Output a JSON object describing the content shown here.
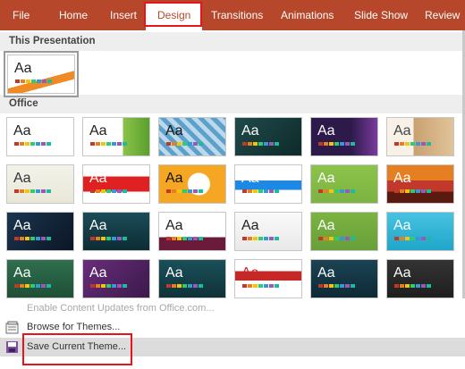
{
  "ribbon": {
    "tabs": [
      {
        "label": "File"
      },
      {
        "label": "Home"
      },
      {
        "label": "Insert"
      },
      {
        "label": "Design"
      },
      {
        "label": "Transitions"
      },
      {
        "label": "Animations"
      },
      {
        "label": "Slide Show"
      },
      {
        "label": "Review"
      }
    ],
    "active_tab": "Design"
  },
  "gallery": {
    "this_presentation_heading": "This Presentation",
    "office_heading": "Office",
    "sample_text": "Aa"
  },
  "menu": {
    "enable_updates": "Enable Content Updates from Office.com...",
    "browse_themes": "Browse for Themes...",
    "save_theme": "Save Current Theme..."
  },
  "colors": {
    "ribbon": "#b7472a",
    "highlight": "#e8141b"
  }
}
